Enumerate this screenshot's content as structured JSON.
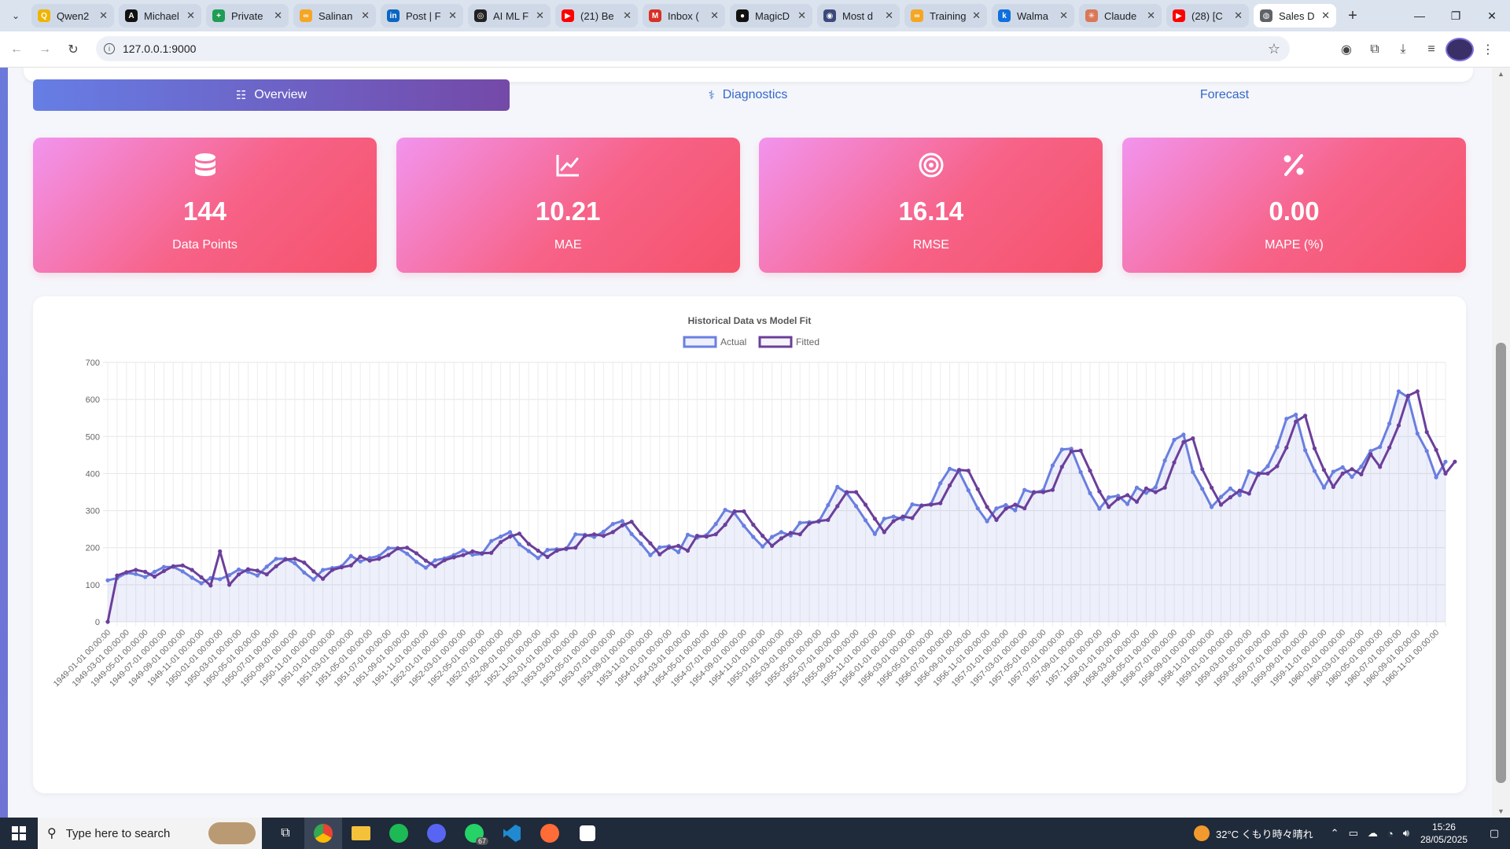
{
  "browser": {
    "tabs": [
      {
        "title": "Qwen2",
        "color": "#f0b400",
        "glyph": "Q",
        "active": false
      },
      {
        "title": "Michael",
        "color": "#111111",
        "glyph": "A",
        "active": false
      },
      {
        "title": "Private",
        "color": "#1f9d55",
        "glyph": "+",
        "active": false
      },
      {
        "title": "Salinan",
        "color": "#f5a623",
        "glyph": "∞",
        "active": false
      },
      {
        "title": "Post | F",
        "color": "#0a66c2",
        "glyph": "in",
        "active": false
      },
      {
        "title": "AI ML F",
        "color": "#222222",
        "glyph": "◎",
        "active": false
      },
      {
        "title": "(21) Be",
        "color": "#ff0000",
        "glyph": "▶",
        "active": false
      },
      {
        "title": "Inbox (",
        "color": "#d93025",
        "glyph": "M",
        "active": false
      },
      {
        "title": "MagicD",
        "color": "#111111",
        "glyph": "●",
        "active": false
      },
      {
        "title": "Most d",
        "color": "#3b4a7a",
        "glyph": "◉",
        "active": false
      },
      {
        "title": "Training",
        "color": "#f5a623",
        "glyph": "∞",
        "active": false
      },
      {
        "title": "Walma",
        "color": "#0f6fde",
        "glyph": "k",
        "active": false
      },
      {
        "title": "Claude",
        "color": "#d97757",
        "glyph": "✳",
        "active": false
      },
      {
        "title": "(28) [C",
        "color": "#ff0000",
        "glyph": "▶",
        "active": false
      },
      {
        "title": "Sales D",
        "color": "#5f6368",
        "glyph": "◍",
        "active": true
      }
    ],
    "url": "127.0.0.1:9000"
  },
  "nav": {
    "tabs": [
      {
        "label": "Overview",
        "icon": "bar-chart-icon",
        "glyph": "☷"
      },
      {
        "label": "Diagnostics",
        "icon": "stethoscope-icon",
        "glyph": "⚕"
      },
      {
        "label": "Forecast",
        "icon": "",
        "glyph": ""
      }
    ],
    "active": 0
  },
  "stats": [
    {
      "value": "144",
      "label": "Data Points",
      "icon": "database-icon"
    },
    {
      "value": "10.21",
      "label": "MAE",
      "icon": "line-chart-icon"
    },
    {
      "value": "16.14",
      "label": "RMSE",
      "icon": "target-icon"
    },
    {
      "value": "0.00",
      "label": "MAPE (%)",
      "icon": "percent-icon"
    }
  ],
  "chart_data": {
    "type": "line",
    "title": "Historical Data vs Model Fit",
    "xlabel": "",
    "ylabel": "",
    "ylim": [
      0,
      700
    ],
    "yticks": [
      0,
      100,
      200,
      300,
      400,
      500,
      600,
      700
    ],
    "grid": true,
    "legend_position": "top-center",
    "x_start": "1949-01-01",
    "x_label_format": "YYYY-MM-01 00:00:00",
    "x_label_every": 2,
    "series": [
      {
        "name": "Actual",
        "color": "#6a7fe0",
        "fill": "rgba(106,127,224,0.12)",
        "values": [
          112,
          118,
          132,
          129,
          121,
          135,
          148,
          148,
          136,
          119,
          104,
          118,
          115,
          126,
          141,
          135,
          125,
          149,
          170,
          170,
          158,
          133,
          114,
          140,
          145,
          150,
          178,
          163,
          172,
          178,
          199,
          199,
          184,
          162,
          146,
          166,
          171,
          180,
          193,
          181,
          183,
          218,
          230,
          242,
          209,
          191,
          172,
          194,
          196,
          196,
          236,
          235,
          229,
          243,
          264,
          272,
          237,
          211,
          180,
          201,
          204,
          188,
          235,
          227,
          234,
          264,
          302,
          293,
          259,
          229,
          203,
          229,
          242,
          233,
          267,
          269,
          270,
          315,
          364,
          347,
          312,
          274,
          237,
          278,
          284,
          277,
          317,
          313,
          318,
          374,
          413,
          405,
          355,
          306,
          271,
          306,
          315,
          301,
          356,
          348,
          355,
          422,
          465,
          467,
          404,
          347,
          305,
          336,
          340,
          318,
          362,
          348,
          363,
          435,
          491,
          505,
          404,
          359,
          310,
          337,
          360,
          342,
          406,
          396,
          420,
          472,
          548,
          559,
          463,
          407,
          362,
          405,
          417,
          391,
          419,
          461,
          472,
          535,
          622,
          606,
          508,
          461,
          390,
          432
        ]
      },
      {
        "name": "Fitted",
        "color": "#6b3f9a",
        "fill": "none",
        "values": [
          0,
          125,
          134,
          140,
          135,
          122,
          137,
          150,
          152,
          140,
          120,
          98,
          190,
          100,
          128,
          142,
          138,
          128,
          150,
          168,
          170,
          160,
          136,
          116,
          140,
          147,
          152,
          176,
          165,
          170,
          180,
          198,
          200,
          185,
          165,
          150,
          166,
          174,
          180,
          190,
          185,
          186,
          215,
          230,
          238,
          210,
          192,
          175,
          192,
          198,
          200,
          232,
          236,
          232,
          242,
          260,
          270,
          238,
          212,
          182,
          200,
          205,
          192,
          232,
          230,
          236,
          262,
          298,
          298,
          262,
          232,
          205,
          225,
          240,
          236,
          265,
          272,
          275,
          312,
          350,
          350,
          316,
          278,
          242,
          272,
          284,
          280,
          314,
          316,
          320,
          368,
          410,
          408,
          358,
          310,
          275,
          305,
          316,
          306,
          350,
          350,
          356,
          418,
          460,
          462,
          408,
          352,
          310,
          332,
          342,
          324,
          360,
          350,
          362,
          430,
          485,
          495,
          412,
          362,
          316,
          336,
          354,
          346,
          400,
          400,
          420,
          470,
          540,
          556,
          468,
          410,
          364,
          400,
          412,
          398,
          452,
          418,
          470,
          530,
          610,
          622,
          512,
          464,
          400,
          432
        ]
      }
    ]
  }
}
